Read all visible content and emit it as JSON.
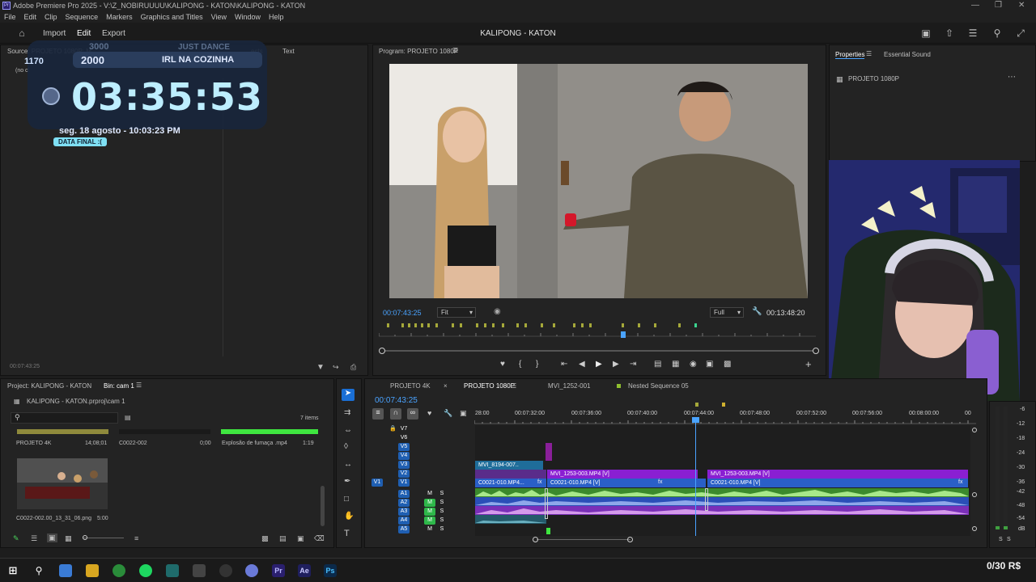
{
  "window": {
    "title": "Adobe Premiere Pro 2025 - V:\\Z_NOBIRUUUU\\KALIPONG - KATON\\KALIPONG - KATON",
    "logo": "Pr"
  },
  "menu": [
    "File",
    "Edit",
    "Clip",
    "Sequence",
    "Markers",
    "Graphics and Titles",
    "View",
    "Window",
    "Help"
  ],
  "header": {
    "import": "Import",
    "edit": "Edit",
    "export": "Export",
    "project_title": "KALIPONG - KATON"
  },
  "source_panel": {
    "tab": "Source: PROJETO 1080P: M",
    "tab_effects": "ects",
    "tab_text": "Text",
    "no_clip": "(no cl",
    "timecode": "00:07:43:25"
  },
  "widget": {
    "top_left": "1170",
    "faded_left": "3000",
    "faded_right": "JUST DANCE",
    "count": "2000",
    "goal": "IRL NA COZINHA",
    "timer": "03:35:53",
    "date": "seg. 18 agosto - 10:03:23 PM",
    "badge": "DATA FINAL :("
  },
  "program_panel": {
    "tab": "Program: PROJETO 1080P",
    "timecode": "00:07:43:25",
    "fit": "Fit",
    "quality": "Full",
    "duration": "00:13:48:20"
  },
  "properties_panel": {
    "tab": "Properties",
    "tab2": "Essential Sound",
    "sequence": "PROJETO 1080P"
  },
  "project_panel": {
    "tab": "Project: KALIPONG - KATON",
    "bin_tab": "Bin: cam 1",
    "path": "KALIPONG - KATON.prproj\\cam 1",
    "items": "7 items",
    "row1": [
      {
        "name": "PROJETO 4K",
        "dur": "14;08;01"
      },
      {
        "name": "C0022-002",
        "dur": "0;00"
      },
      {
        "name": "Explosão de fumaça .mp4",
        "dur": "1:19"
      }
    ],
    "thumb": {
      "name": "C0022-002.00_13_31_06.png",
      "dur": "5:00"
    }
  },
  "timeline": {
    "tabs": [
      "PROJETO 4K",
      "PROJETO 1080P",
      "MVI_1252-001",
      "Nested Sequence 05"
    ],
    "timecode": "00:07:43:25",
    "ruler": [
      "28:00",
      "00:07:32:00",
      "00:07:36:00",
      "00:07:40:00",
      "00:07:44:00",
      "00:07:48:00",
      "00:07:52:00",
      "00:07:56:00",
      "00:08:00:00",
      "00"
    ],
    "video_tracks": [
      "V7",
      "V6",
      "V5",
      "V4",
      "V3",
      "V2",
      "V1"
    ],
    "audio_tracks": [
      "A1",
      "A2",
      "A3",
      "A4",
      "A5"
    ],
    "source_patch": "V1",
    "clips": {
      "v3": "MVI_8194-007..",
      "v2a": "MVI_1253-003.MP4 [V]",
      "v2b": "MVI_1253-003.MP4 [V]",
      "v1a": "C0021-010.MP4...",
      "v1b": "C0021-010.MP4 [V]",
      "v1c": "C0021-010.MP4 [V]"
    },
    "track_buttons": {
      "mute": "M",
      "solo": "S"
    },
    "fx": "fx"
  },
  "meters": {
    "scale": [
      "-6",
      "-12",
      "-18",
      "-24",
      "-30",
      "-36",
      "-42",
      "-48",
      "-54",
      "dB"
    ],
    "solo": "S"
  },
  "donation_bar": {
    "label": "0/30 R$"
  },
  "taskbar": {
    "premiere": "Pr",
    "after_effects": "Ae",
    "photoshop": "Ps"
  }
}
